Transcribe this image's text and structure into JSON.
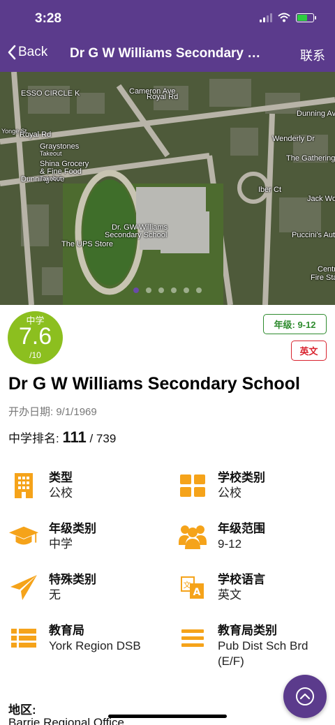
{
  "status": {
    "time": "3:28"
  },
  "nav": {
    "back_label": "Back",
    "title": "Dr G W Williams Secondary S...",
    "contact_label": "联系"
  },
  "map": {
    "labels": {
      "esso": "ESSO CIRCLE K",
      "royal": "Royal Rd",
      "royal2": "Royal Rd",
      "cameron": "Cameron Ave",
      "dunning": "Dunning Ave",
      "dunning2": "Dunning Ave",
      "graystones": "Graystones",
      "takeout1": "Takeout",
      "shina": "Shina Grocery",
      "finefood": "& Fine Food",
      "takeout2": "Takeout",
      "school1": "Dr. GW Williams",
      "school2": "Secondary School",
      "ups": "The UPS Store",
      "wenderly": "Wenderly Dr",
      "iber": "Iber Ct",
      "gathering": "The Gathering",
      "jackwo": "Jack Wo",
      "puccini": "Puccini's Auto C",
      "centr": "Centr",
      "fire": "Fire Stat",
      "yonge": "Yonge St"
    },
    "page_count": 6,
    "active_page": 1
  },
  "rating": {
    "level": "中学",
    "score": "7.6",
    "out_of": "/10"
  },
  "tags": {
    "grade": "年级: 9-12",
    "language": "英文"
  },
  "school": {
    "name": "Dr G W Williams Secondary School",
    "founded": "开办日期: 9/1/1969",
    "rank_label": "中学排名: ",
    "rank": "111",
    "rank_total": " / 739"
  },
  "info": {
    "type": {
      "label": "类型",
      "value": "公校",
      "icon": "building-icon"
    },
    "category": {
      "label": "学校类别",
      "value": "公校",
      "icon": "grid-icon"
    },
    "grade_type": {
      "label": "年级类别",
      "value": "中学",
      "icon": "graduation-cap-icon"
    },
    "grade_range": {
      "label": "年级范围",
      "value": "9-12",
      "icon": "users-icon"
    },
    "special": {
      "label": "特殊类别",
      "value": "无",
      "icon": "paper-plane-icon"
    },
    "language": {
      "label": "学校语言",
      "value": "英文",
      "icon": "translate-icon"
    },
    "board": {
      "label": "教育局",
      "value": "York Region DSB",
      "icon": "list-icon"
    },
    "board_type": {
      "label": "教育局类别",
      "value": "Pub Dist Sch Brd",
      "value2": "(E/F)",
      "icon": "menu-icon"
    }
  },
  "district": {
    "label": "地区:",
    "value": "Barrie Regional Office"
  },
  "colors": {
    "brand": "#5b3b8c",
    "icon_orange": "#f5a31a",
    "rating_green": "#8cbf1f",
    "grade_green": "#2e8b2e",
    "lang_red": "#d9232e"
  }
}
